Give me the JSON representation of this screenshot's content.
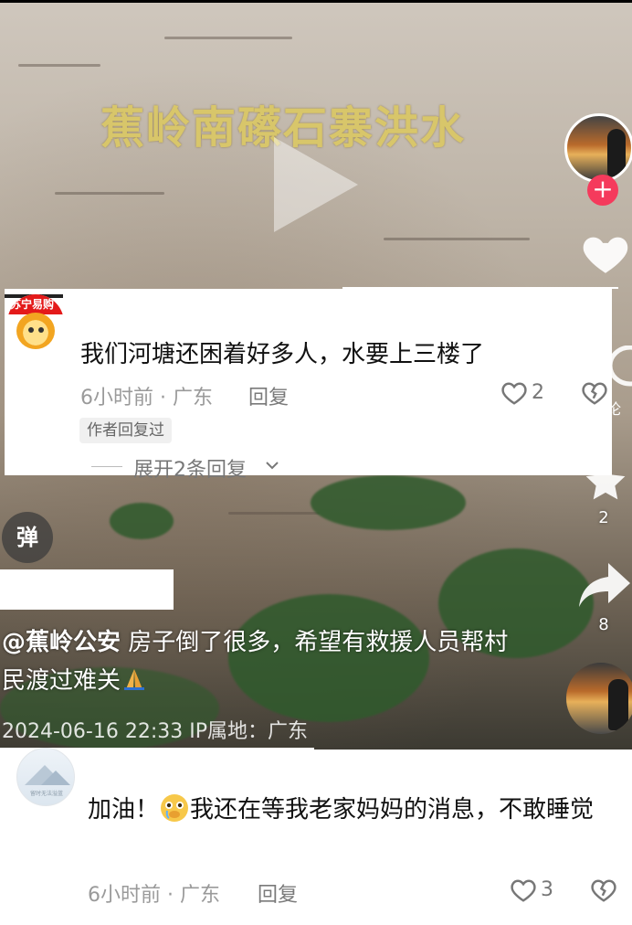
{
  "video": {
    "overlay_title": "蕉岭南礤石寨洪水",
    "caption_mention": "@蕉岭公安",
    "caption_text": " 房子倒了很多，希望有救援人员帮村民渡过难关",
    "date_location": "2024-06-16 22:33  IP属地：广东",
    "danmu_label": "弹"
  },
  "rail": {
    "follow_symbol": "+",
    "comment_count_partial": "论",
    "favorite_count": "2",
    "share_count": "8"
  },
  "comment1": {
    "text": "我们河塘还困着好多人，水要上三楼了",
    "time_location": "6小时前 · 广东",
    "reply_label": "回复",
    "like_count": "2",
    "author_badge": "作者回复过",
    "expand_label": "展开2条回复",
    "logo_text": "苏宁易购"
  },
  "comment2": {
    "text_before": "加油！",
    "text_after": "我还在等我老家妈妈的消息，不敢睡觉",
    "time_location": "6小时前 · 广东",
    "reply_label": "回复",
    "like_count": "3",
    "avatar_text": "留时无法溢蓝"
  },
  "icons": [
    "play-icon",
    "heart-icon",
    "star-icon",
    "share-icon",
    "comment-icon",
    "dislike-icon",
    "chevron-down-icon",
    "pray-emoji-icon",
    "teary-face-emoji-icon"
  ],
  "colors": {
    "follow_red": "#f53a5c",
    "title_gold": "#d8c66a"
  }
}
